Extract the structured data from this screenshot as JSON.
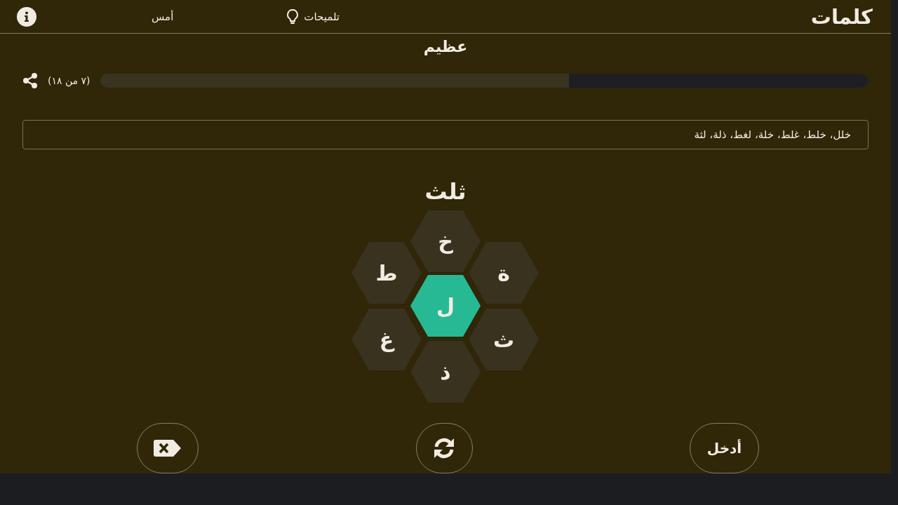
{
  "header": {
    "title": "كلمات",
    "hints": "تلميحات",
    "yesterday": "أمس"
  },
  "rank": "عظيم",
  "progress": {
    "level": 0.39,
    "label": "(٧ من ١٨)"
  },
  "found_words": "خلل، خلط، غلط، خلة، لغط، ذلة، لثة",
  "current_word": "ثلث",
  "letters": [
    {
      "letter": "خ",
      "kind": "outer"
    },
    {
      "letter": "ة",
      "kind": "outer"
    },
    {
      "letter": "ط",
      "kind": "outer"
    },
    {
      "letter": "ل",
      "kind": "center"
    },
    {
      "letter": "ث",
      "kind": "outer"
    },
    {
      "letter": "غ",
      "kind": "outer"
    },
    {
      "letter": "ذ",
      "kind": "outer"
    }
  ],
  "enter_button": "أدخل"
}
